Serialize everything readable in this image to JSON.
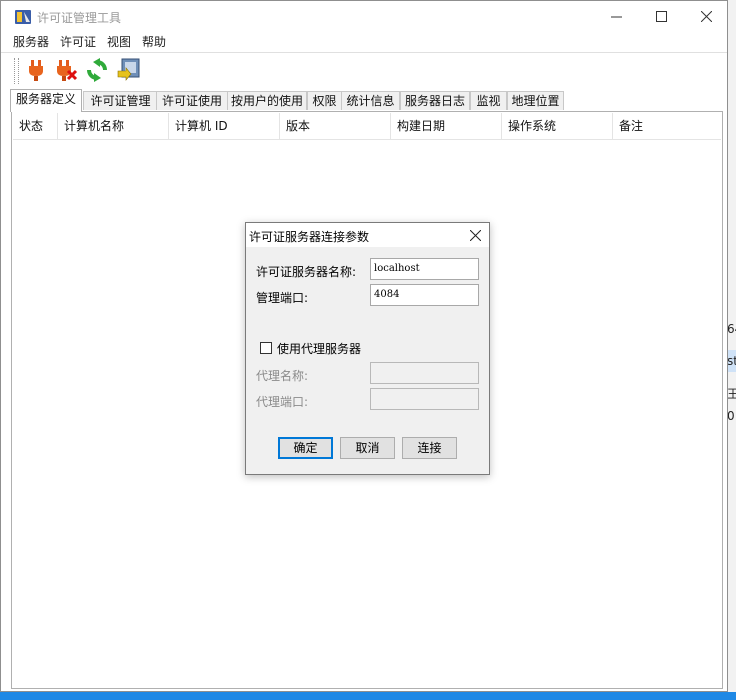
{
  "window": {
    "title": "许可证管理工具"
  },
  "menu": [
    "服务器",
    "许可证",
    "视图",
    "帮助"
  ],
  "toolbar": {
    "buttons": [
      {
        "icon": "plug-connect-icon"
      },
      {
        "icon": "plug-disconnect-icon"
      },
      {
        "icon": "refresh-icon"
      },
      {
        "icon": "export-icon"
      }
    ]
  },
  "tabs": [
    "服务器定义",
    "许可证管理",
    "许可证使用",
    "按用户的使用",
    "权限",
    "统计信息",
    "服务器日志",
    "监视",
    "地理位置"
  ],
  "active_tab": 0,
  "table": {
    "columns": [
      "状态",
      "计算机名称",
      "计算机 ID",
      "版本",
      "构建日期",
      "操作系统",
      "备注"
    ]
  },
  "dialog": {
    "title": "许可证服务器连接参数",
    "server_name_label": "许可证服务器名称:",
    "server_name_value": "localhost",
    "port_label": "管理端口:",
    "port_value": "4084",
    "use_proxy_label": "使用代理服务器",
    "use_proxy_checked": false,
    "proxy_name_label": "代理名称:",
    "proxy_port_label": "代理端口:",
    "ok_label": "确定",
    "cancel_label": "取消",
    "connect_label": "连接"
  },
  "background_peek": [
    "64",
    "st",
    "王",
    "0"
  ]
}
